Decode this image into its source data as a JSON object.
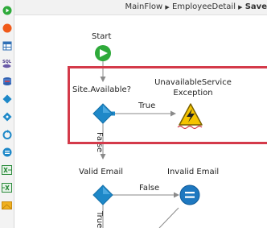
{
  "breadcrumb": {
    "items": [
      "MainFlow",
      "EmployeeDetail",
      "Save"
    ],
    "separator": "▶"
  },
  "toolbox": {
    "items": [
      {
        "icon": "start-node-icon",
        "color": "#2eaa3a"
      },
      {
        "icon": "end-node-icon",
        "color": "#f05a1a"
      },
      {
        "icon": "aggregate-icon",
        "color": "#2f6fb5"
      },
      {
        "icon": "sql-icon",
        "color": "#4a3a8a"
      },
      {
        "icon": "refresh-data-icon",
        "color": "#3060b0"
      },
      {
        "icon": "if-diamond-icon",
        "color": "#1e88c8"
      },
      {
        "icon": "switch-icon",
        "color": "#1e88c8"
      },
      {
        "icon": "for-each-icon",
        "color": "#1e88c8"
      },
      {
        "icon": "assign-icon",
        "color": "#1e88c8"
      },
      {
        "icon": "excel-to-record-icon",
        "color": "#2a8a3a"
      },
      {
        "icon": "record-to-excel-icon",
        "color": "#2a8a3a"
      },
      {
        "icon": "json-icon",
        "color": "#f0b020"
      }
    ]
  },
  "flow": {
    "start_label": "Start",
    "site_available_label": "Site.Available?",
    "exception_label_line1": "UnavailableService",
    "exception_label_line2": "Exception",
    "true_label": "True",
    "false_label_vertical": "False",
    "valid_email_label": "Valid Email",
    "invalid_email_label": "Invalid Email",
    "false_label": "False",
    "true_label_vertical": "True"
  },
  "colors": {
    "highlight_border": "#d43a4a",
    "node_blue": "#1e88c8",
    "start_green": "#2eaa3a",
    "warning_yellow": "#f5c400",
    "connector_gray": "#8a8a8a"
  }
}
